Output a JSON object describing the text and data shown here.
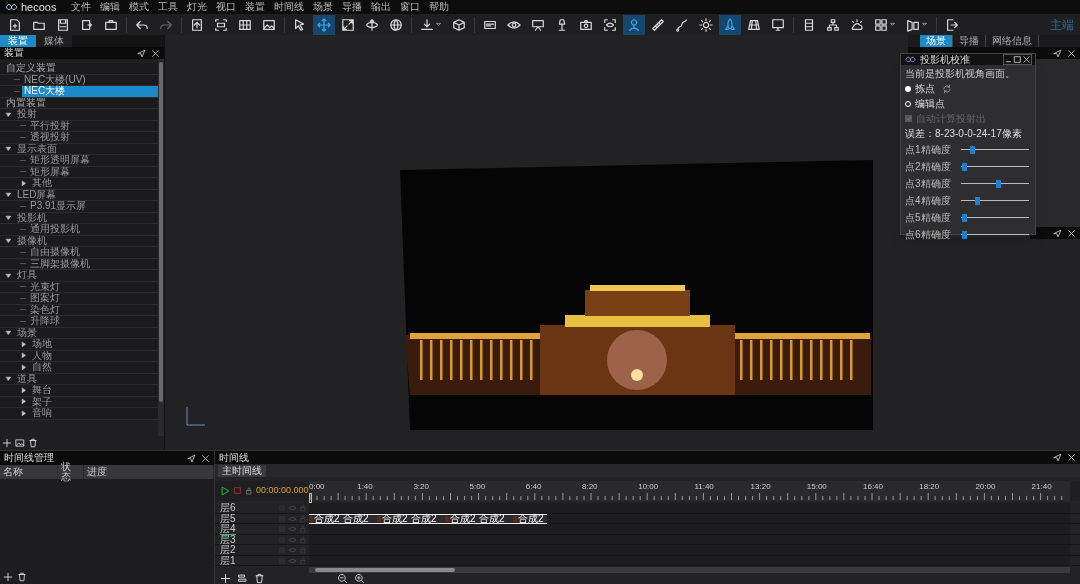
{
  "app": {
    "logo": "hecoos",
    "menu": [
      "文件",
      "编辑",
      "模式",
      "工具",
      "灯光",
      "视口",
      "装置",
      "时间线",
      "场景",
      "导播",
      "输出",
      "窗口",
      "帮助"
    ],
    "mode_label": "主端"
  },
  "toolbar": [
    {
      "selected": false
    },
    {
      "selected": false
    },
    {
      "selected": false
    },
    {
      "selected": false
    },
    {
      "selected": false
    },
    {
      "selected": false
    },
    {
      "selected": false
    },
    {
      "selected": false
    },
    {
      "selected": false
    },
    {
      "selected": false
    },
    {
      "selected": false
    },
    {
      "selected": false
    },
    {
      "selected": true
    },
    {
      "selected": false
    },
    {
      "selected": false
    },
    {
      "selected": false
    },
    {
      "selected": false
    },
    {
      "selected": false
    },
    {
      "selected": false
    },
    {
      "selected": false
    },
    {
      "selected": false
    },
    {
      "selected": false
    },
    {
      "selected": false
    },
    {
      "selected": false
    },
    {
      "selected": true
    },
    {
      "selected": false
    },
    {
      "selected": false
    },
    {
      "selected": false
    },
    {
      "selected": true
    },
    {
      "selected": false
    },
    {
      "selected": false
    },
    {
      "selected": false
    },
    {
      "selected": false
    },
    {
      "selected": false
    },
    {
      "selected": false
    },
    {
      "selected": false
    },
    {
      "selected": false
    }
  ],
  "left_panel": {
    "tabs": [
      {
        "label": "装置",
        "selected": true
      },
      {
        "label": "媒体",
        "selected": false
      }
    ],
    "title": "装置",
    "tree": [
      {
        "label": "自定义装置",
        "selected": false,
        "children": [
          {
            "label": "NEC大楼(UV)",
            "selected": false
          },
          {
            "label": "NEC大楼",
            "selected": true
          }
        ]
      },
      {
        "label": "内置装置",
        "selected": false,
        "children": [
          {
            "label": "投射",
            "selected": false,
            "expanded": true,
            "children": [
              {
                "label": "平行投射",
                "selected": false
              },
              {
                "label": "透视投射",
                "selected": false
              }
            ]
          },
          {
            "label": "显示表面",
            "selected": false,
            "expanded": true,
            "children": [
              {
                "label": "矩形透明屏幕",
                "selected": false
              },
              {
                "label": "矩形屏幕",
                "selected": false
              },
              {
                "label": "其他",
                "selected": false,
                "expanded": false
              }
            ]
          },
          {
            "label": "LED屏幕",
            "selected": false,
            "expanded": true,
            "children": [
              {
                "label": "P3.91显示屏",
                "selected": false
              }
            ]
          },
          {
            "label": "投影机",
            "selected": false,
            "expanded": true,
            "children": [
              {
                "label": "通用投影机",
                "selected": false
              }
            ]
          },
          {
            "label": "摄像机",
            "selected": false,
            "expanded": true,
            "children": [
              {
                "label": "自由摄像机",
                "selected": false
              },
              {
                "label": "三脚架摄像机",
                "selected": false
              }
            ]
          },
          {
            "label": "灯具",
            "selected": false,
            "expanded": true,
            "children": [
              {
                "label": "光束灯",
                "selected": false
              },
              {
                "label": "图案灯",
                "selected": false
              },
              {
                "label": "染色灯",
                "selected": false
              },
              {
                "label": "升降球",
                "selected": false
              }
            ]
          },
          {
            "label": "场景",
            "selected": false,
            "expanded": true,
            "children": [
              {
                "label": "场地",
                "selected": false,
                "expanded": false
              },
              {
                "label": "人物",
                "selected": false,
                "expanded": false
              },
              {
                "label": "自然",
                "selected": false,
                "expanded": false
              }
            ]
          },
          {
            "label": "道具",
            "selected": false,
            "expanded": true,
            "children": [
              {
                "label": "舞台",
                "selected": false,
                "expanded": false
              },
              {
                "label": "架子",
                "selected": false,
                "expanded": false
              },
              {
                "label": "音响",
                "selected": false,
                "expanded": false
              }
            ]
          }
        ]
      }
    ]
  },
  "right_panel": {
    "tabs": [
      {
        "label": "场景",
        "selected": true
      },
      {
        "label": "导播",
        "selected": false
      },
      {
        "label": "网络信息",
        "selected": false
      }
    ]
  },
  "calibration_dialog": {
    "title": "投影机校准",
    "message": "当前是投影机视角画面。",
    "modes": [
      {
        "label": "拣点",
        "selected": true
      },
      {
        "label": "编辑点",
        "selected": false
      }
    ],
    "auto_calc": {
      "label": "自动计算投射出",
      "checked": true,
      "disabled": true
    },
    "error_text": "误差：8-23-0-0-24-17像素",
    "sliders": [
      {
        "label": "点1精确度",
        "level": 0.15
      },
      {
        "label": "点2精确度",
        "level": 0.02
      },
      {
        "label": "点3精确度",
        "level": 0.55
      },
      {
        "label": "点4精确度",
        "level": 0.22
      },
      {
        "label": "点5精确度",
        "level": 0.02
      },
      {
        "label": "点6精确度",
        "level": 0.02
      }
    ]
  },
  "timeline_manager": {
    "title": "时间线管理",
    "columns": [
      "名称",
      "状态",
      "进度"
    ]
  },
  "timeline": {
    "title": "时间线",
    "tabs": [
      {
        "label": "主时间线",
        "selected": true
      }
    ],
    "time": "00:00:00.000",
    "ruler": [
      "0:00",
      "1:40",
      "3:20",
      "5:00",
      "6:40",
      "8:20",
      "10:00",
      "11:40",
      "13:20",
      "15:00",
      "16:40",
      "18:20",
      "20:00",
      "21:40"
    ],
    "layers": [
      {
        "label": "层6",
        "selected": false
      },
      {
        "label": "层5",
        "selected": false,
        "clips": [
          {
            "label": "合成2",
            "thumbnail": true
          },
          {
            "label": "合成2",
            "thumbnail": false
          },
          {
            "label": "合成2",
            "thumbnail": true
          },
          {
            "label": "合成2",
            "thumbnail": false
          },
          {
            "label": "合成2",
            "thumbnail": true
          },
          {
            "label": "合成2",
            "thumbnail": false
          },
          {
            "label": "合成2",
            "thumbnail": true
          }
        ]
      },
      {
        "label": "层4",
        "selected": true
      },
      {
        "label": "层3",
        "selected": false
      },
      {
        "label": "层2",
        "selected": false
      },
      {
        "label": "层1",
        "selected": false
      }
    ]
  }
}
